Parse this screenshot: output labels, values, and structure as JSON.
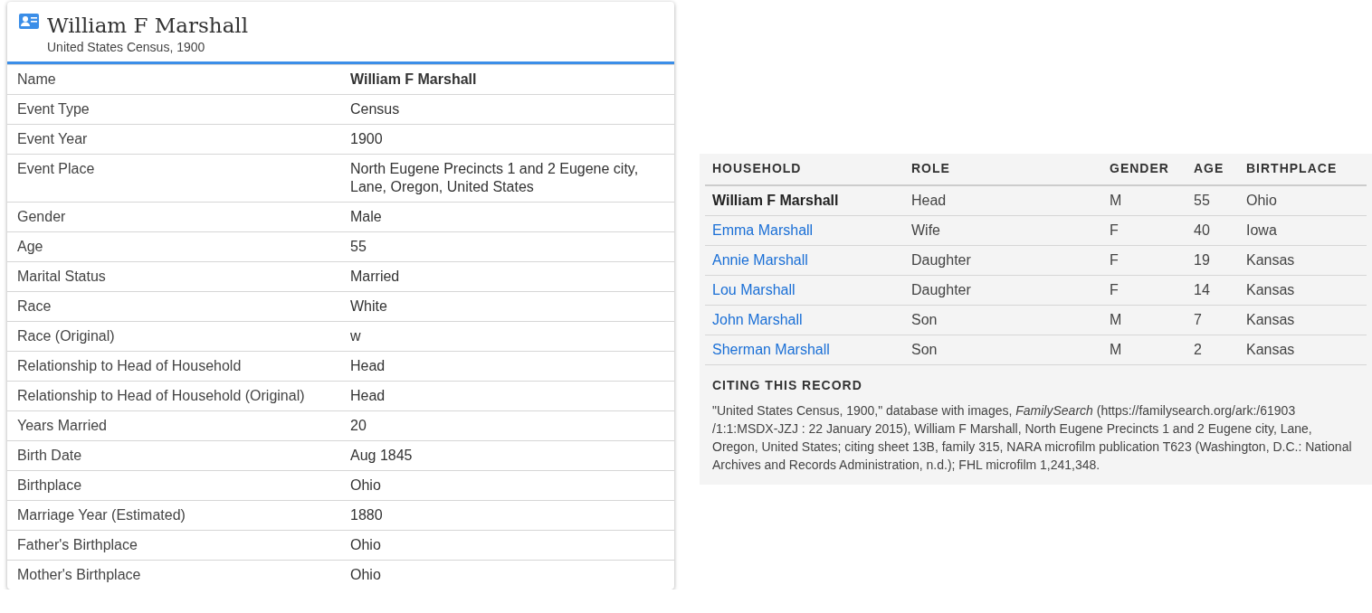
{
  "record": {
    "title": "William F Marshall",
    "subtitle": "United States Census, 1900",
    "fields": [
      {
        "label": "Name",
        "value": "William F Marshall",
        "kind": "bold"
      },
      {
        "label": "Event Type",
        "value": "Census",
        "kind": "plain"
      },
      {
        "label": "Event Year",
        "value": "1900",
        "kind": "plain"
      },
      {
        "label": "Event Place",
        "value": "North Eugene Precincts 1 and 2 Eugene city, Lane, Oregon, United States",
        "kind": "plain"
      },
      {
        "label": "Gender",
        "value": "Male",
        "kind": "plain"
      },
      {
        "label": "Age",
        "value": "55",
        "kind": "plain"
      },
      {
        "label": "Marital Status",
        "value": "Married",
        "kind": "plain"
      },
      {
        "label": "Race",
        "value": "White",
        "kind": "plain"
      },
      {
        "label": "Race (Original)",
        "value": "w",
        "kind": "plain"
      },
      {
        "label": "Relationship to Head of Household",
        "value": "Head",
        "kind": "plain"
      },
      {
        "label": "Relationship to Head of Household (Original)",
        "value": "Head",
        "kind": "plain"
      },
      {
        "label": "Years Married",
        "value": "20",
        "kind": "plain"
      },
      {
        "label": "Birth Date",
        "value": "Aug 1845",
        "kind": "plain"
      },
      {
        "label": "Birthplace",
        "value": "Ohio",
        "kind": "plain"
      },
      {
        "label": "Marriage Year (Estimated)",
        "value": "1880",
        "kind": "plain"
      },
      {
        "label": "Father's Birthplace",
        "value": "Ohio",
        "kind": "plain"
      },
      {
        "label": "Mother's Birthplace",
        "value": "Ohio",
        "kind": "plain"
      }
    ]
  },
  "household": {
    "columns": [
      "HOUSEHOLD",
      "ROLE",
      "GENDER",
      "AGE",
      "BIRTHPLACE"
    ],
    "rows": [
      {
        "kind": "self",
        "name": "William F Marshall",
        "role": "Head",
        "gender": "M",
        "age": "55",
        "birthplace": "Ohio"
      },
      {
        "kind": "link",
        "name": "Emma Marshall",
        "role": "Wife",
        "gender": "F",
        "age": "40",
        "birthplace": "Iowa"
      },
      {
        "kind": "link",
        "name": "Annie Marshall",
        "role": "Daughter",
        "gender": "F",
        "age": "19",
        "birthplace": "Kansas"
      },
      {
        "kind": "link",
        "name": "Lou Marshall",
        "role": "Daughter",
        "gender": "F",
        "age": "14",
        "birthplace": "Kansas"
      },
      {
        "kind": "link",
        "name": "John Marshall",
        "role": "Son",
        "gender": "M",
        "age": "7",
        "birthplace": "Kansas"
      },
      {
        "kind": "link",
        "name": "Sherman Marshall",
        "role": "Son",
        "gender": "M",
        "age": "2",
        "birthplace": "Kansas"
      }
    ]
  },
  "citation": {
    "heading": "CITING THIS RECORD",
    "text": "\"United States Census, 1900,\" database with images, *FamilySearch* (https://familysearch.org/ark:/61903 /1:1:MSDX-JZJ : 22 January 2015), William F Marshall, North Eugene Precincts 1 and 2 Eugene city, Lane, Oregon, United States; citing sheet 13B, family 315, NARA microfilm publication T623 (Washington, D.C.: National Archives and Records Administration, n.d.); FHL microfilm 1,241,348."
  }
}
